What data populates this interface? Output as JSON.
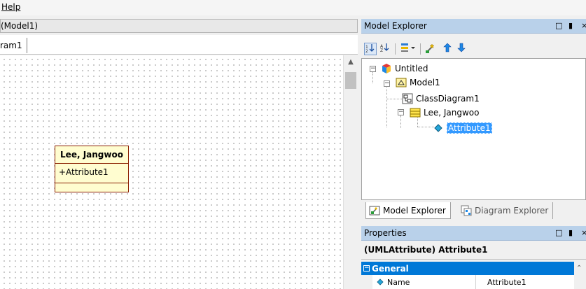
{
  "menu": {
    "help_underlined": "H",
    "help_rest": "elp"
  },
  "diagram": {
    "header_title": "(Model1)",
    "tab_label": "ram1",
    "uml_class": {
      "name": "Lee, Jangwoo",
      "attribute": "+Attribute1"
    }
  },
  "model_explorer": {
    "title": "Model Explorer",
    "controls": {
      "pin": "□",
      "dock": "▮",
      "close": "×"
    },
    "tree": [
      {
        "label": "Untitled",
        "icon": "project-icon"
      },
      {
        "label": "Model1",
        "icon": "model-icon"
      },
      {
        "label": "ClassDiagram1",
        "icon": "class-diagram-icon"
      },
      {
        "label": "Lee, Jangwoo",
        "icon": "class-icon"
      },
      {
        "label": "Attribute1",
        "icon": "attribute-icon",
        "selected": true
      }
    ],
    "tabs": [
      {
        "label": "Model Explorer",
        "active": true
      },
      {
        "label": "Diagram Explorer",
        "active": false
      }
    ]
  },
  "properties": {
    "title": "Properties",
    "object_label": "(UMLAttribute) Attribute1",
    "category": "General",
    "rows": [
      {
        "name": "Name",
        "value": "Attribute1"
      }
    ]
  },
  "colors": {
    "selection": "#3399ff",
    "panel_header": "#b9d1ea",
    "category": "#0078d7",
    "uml_border": "#8a1f00",
    "uml_fill": "#fffdd0"
  }
}
